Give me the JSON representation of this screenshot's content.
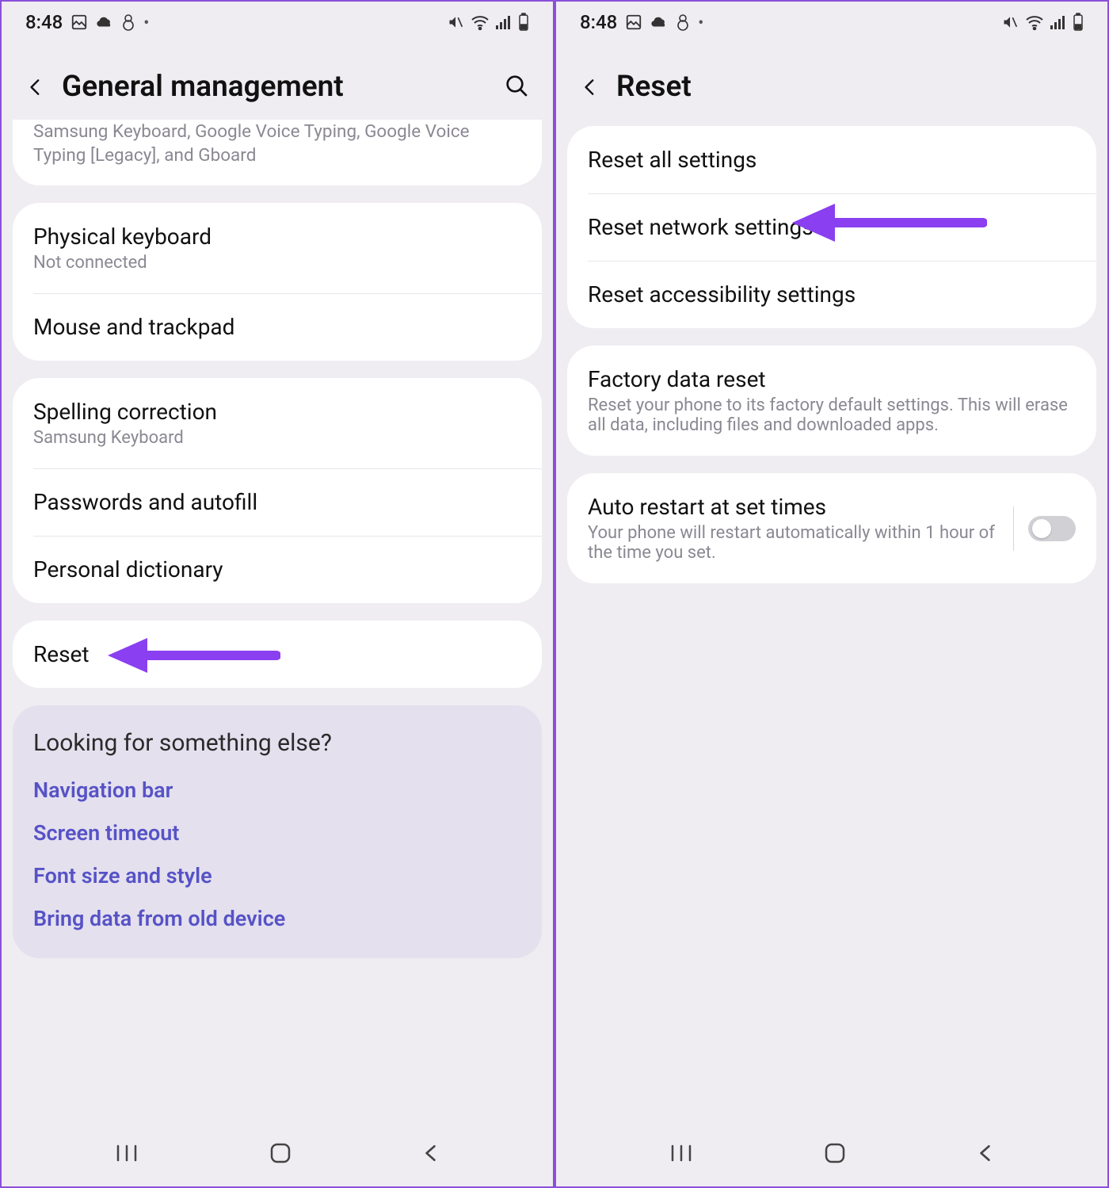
{
  "status": {
    "time": "8:48"
  },
  "left": {
    "title": "General management",
    "keyboard_desc": "Samsung Keyboard, Google Voice Typing, Google Voice Typing [Legacy], and Gboard",
    "rows": {
      "physical_keyboard": {
        "title": "Physical keyboard",
        "sub": "Not connected"
      },
      "mouse": {
        "title": "Mouse and trackpad"
      },
      "spelling": {
        "title": "Spelling correction",
        "sub": "Samsung Keyboard"
      },
      "passwords": {
        "title": "Passwords and autofill"
      },
      "dictionary": {
        "title": "Personal dictionary"
      },
      "reset": {
        "title": "Reset"
      }
    },
    "suggest": {
      "title": "Looking for something else?",
      "links": [
        "Navigation bar",
        "Screen timeout",
        "Font size and style",
        "Bring data from old device"
      ]
    }
  },
  "right": {
    "title": "Reset",
    "rows": {
      "all": {
        "title": "Reset all settings"
      },
      "network": {
        "title": "Reset network settings"
      },
      "accessibility": {
        "title": "Reset accessibility settings"
      },
      "factory": {
        "title": "Factory data reset",
        "sub": "Reset your phone to its factory default settings. This will erase all data, including files and downloaded apps."
      },
      "auto": {
        "title": "Auto restart at set times",
        "sub": "Your phone will restart automatically within 1 hour of the time you set."
      }
    }
  }
}
